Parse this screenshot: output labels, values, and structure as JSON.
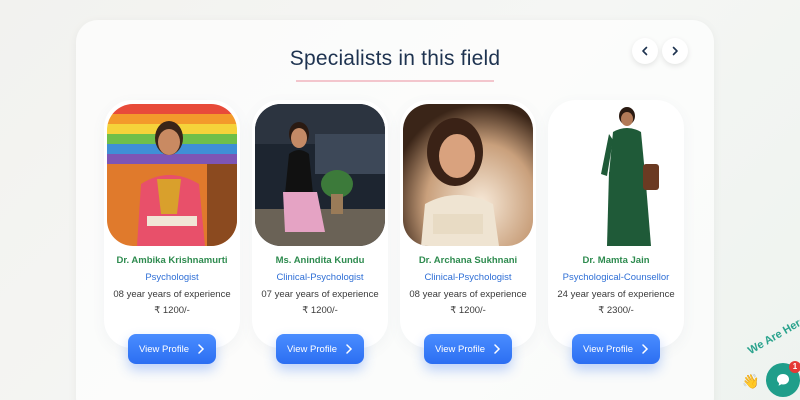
{
  "section": {
    "title": "Specialists in this field",
    "prev_icon": "chevron-left-icon",
    "next_icon": "chevron-right-icon"
  },
  "specialists": [
    {
      "name": "Dr. Ambika Krishnamurti",
      "role": "Psychologist",
      "experience": "08 year years of experience",
      "fee": "₹ 1200/-",
      "button_label": "View Profile"
    },
    {
      "name": "Ms. Anindita Kundu",
      "role": "Clinical-Psychologist",
      "experience": "07 year years of experience",
      "fee": "₹ 1200/-",
      "button_label": "View Profile"
    },
    {
      "name": "Dr. Archana Sukhnani",
      "role": "Clinical-Psychologist",
      "experience": "08 year years of experience",
      "fee": "₹ 1200/-",
      "button_label": "View Profile"
    },
    {
      "name": "Dr. Mamta Jain",
      "role": "Psychological-Counsellor",
      "experience": "24 year years of experience",
      "fee": "₹ 2300/-",
      "button_label": "View Profile"
    }
  ],
  "chat_widget": {
    "text": "We Are Here",
    "badge_count": "1",
    "icon": "chat-bubble-icon"
  },
  "colors": {
    "name": "#2e8b4f",
    "role": "#2f6fd6",
    "button": "#2c6ef2",
    "title": "#1e3350",
    "chat": "#1f9e8a"
  }
}
